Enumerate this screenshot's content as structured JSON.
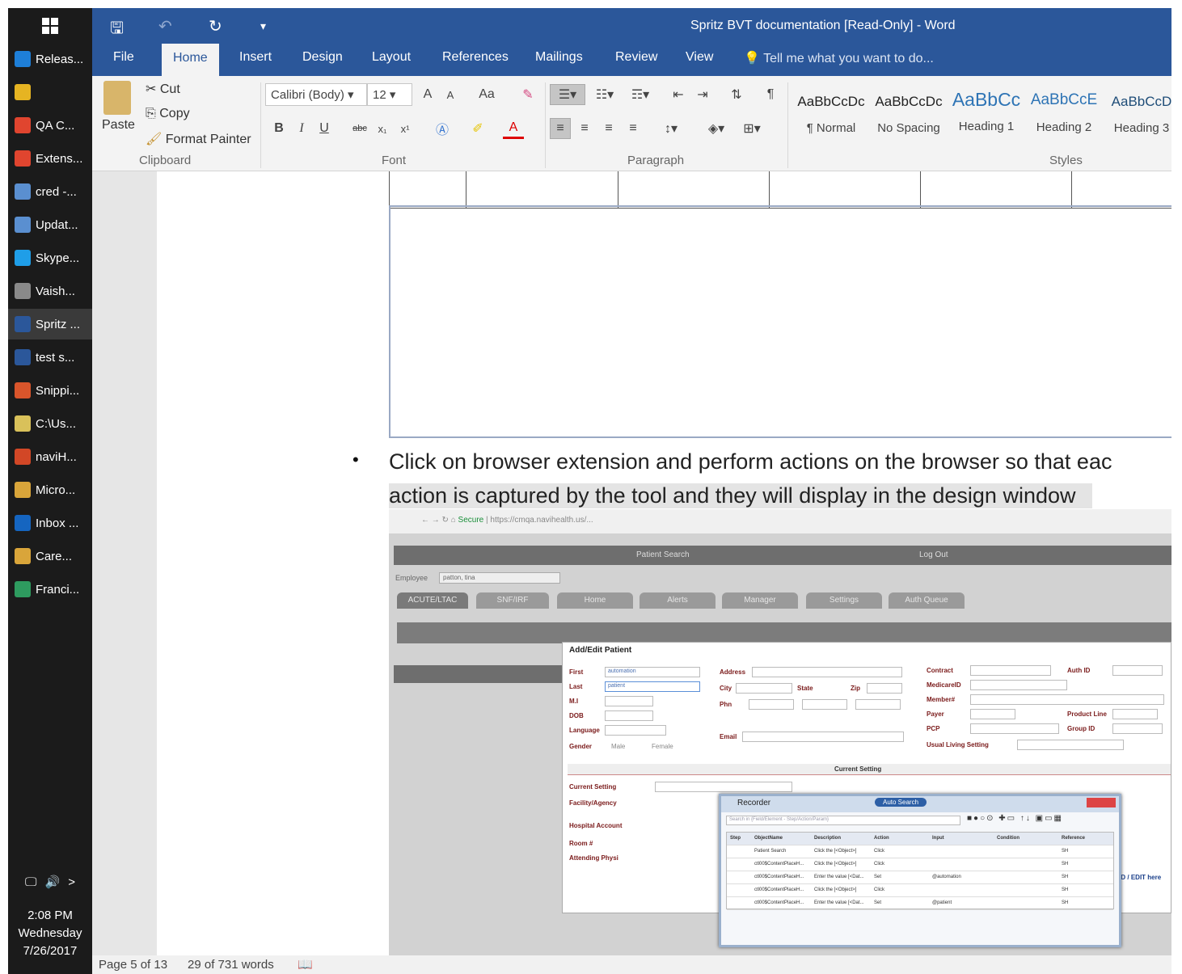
{
  "taskbar": {
    "items": [
      {
        "label": "Releas...",
        "icon": "edge-icon",
        "color": "#1e7fd8"
      },
      {
        "label": "",
        "icon": "file-explorer-icon",
        "color": "#e6b422"
      },
      {
        "label": "QA C...",
        "icon": "chrome-icon",
        "color": "#e0452f"
      },
      {
        "label": "Extens...",
        "icon": "chrome-icon",
        "color": "#e0452f"
      },
      {
        "label": "cred -...",
        "icon": "notepad-icon",
        "color": "#5a8fd0"
      },
      {
        "label": "Updat...",
        "icon": "notepad-icon",
        "color": "#5a8fd0"
      },
      {
        "label": "Skype...",
        "icon": "skype-icon",
        "color": "#1f9ee8"
      },
      {
        "label": "Vaish...",
        "icon": "app-icon",
        "color": "#8a8a8a"
      },
      {
        "label": "Spritz ...",
        "icon": "word-icon",
        "color": "#2b579a"
      },
      {
        "label": "test s...",
        "icon": "word-icon",
        "color": "#2b579a"
      },
      {
        "label": "Snippi...",
        "icon": "snipping-tool-icon",
        "color": "#d9552b"
      },
      {
        "label": "C:\\Us...",
        "icon": "folder-icon",
        "color": "#d9c15a"
      },
      {
        "label": "naviH...",
        "icon": "powerpoint-icon",
        "color": "#d24726"
      },
      {
        "label": "Micro...",
        "icon": "app-icon",
        "color": "#d9a53a"
      },
      {
        "label": "Inbox ...",
        "icon": "outlook-icon",
        "color": "#1565c0"
      },
      {
        "label": "Care...",
        "icon": "app-icon",
        "color": "#d9a53a"
      },
      {
        "label": "Franci...",
        "icon": "app-icon",
        "color": "#2e9b5f"
      }
    ],
    "time": "2:08 PM",
    "day": "Wednesday",
    "date": "7/26/2017"
  },
  "titlebar": {
    "title": "Spritz BVT documentation [Read-Only] - Word"
  },
  "tabs": [
    "File",
    "Home",
    "Insert",
    "Design",
    "Layout",
    "References",
    "Mailings",
    "Review",
    "View"
  ],
  "tell_me": "Tell me what you want to do...",
  "ribbon": {
    "clipboard": {
      "paste": "Paste",
      "cut": "Cut",
      "copy": "Copy",
      "format_painter": "Format Painter",
      "group": "Clipboard"
    },
    "font": {
      "name": "Calibri (Body)",
      "size": "12",
      "group": "Font",
      "case": "Aa",
      "bold": "B",
      "italic": "I",
      "underline": "U",
      "strike": "abc",
      "sub": "x₁",
      "sup": "x¹",
      "grow": "A",
      "shrink": "A"
    },
    "paragraph": {
      "group": "Paragraph"
    },
    "styles": {
      "group": "Styles",
      "items": [
        {
          "preview": "AaBbCcDc",
          "name": "¶ Normal"
        },
        {
          "preview": "AaBbCcDc",
          "name": "No Spacing"
        },
        {
          "preview": "AaBbCc",
          "name": "Heading 1"
        },
        {
          "preview": "AaBbCcE",
          "name": "Heading 2"
        },
        {
          "preview": "AaBbCcD",
          "name": "Heading 3"
        }
      ]
    }
  },
  "document": {
    "bullet": "•",
    "line1": "Click on browser extension and perform actions on the browser so that eac",
    "line2": "action is captured by the tool and they will display in the design window"
  },
  "screenshot": {
    "url": "https://cmqa.navihealth.us/...",
    "secure": "Secure",
    "header_center": "Patient Search",
    "header_right": "Log Out",
    "employee_label": "Employee",
    "employee_value": "patton, tina",
    "tabs": [
      "ACUTE/LTAC",
      "SNF/IRF",
      "Home",
      "Alerts",
      "Manager",
      "Settings",
      "Auth Queue"
    ],
    "dialog_title": "Add/Edit Patient",
    "labels": {
      "first": "First",
      "last": "Last",
      "mi": "M.I",
      "dob": "DOB",
      "language": "Language",
      "gender": "Gender",
      "male": "Male",
      "female": "Female",
      "address": "Address",
      "city": "City",
      "state": "State",
      "zip": "Zip",
      "phone": "Phn",
      "email": "Email",
      "contract": "Contract",
      "auth_id": "Auth ID",
      "medicare": "MedicareID",
      "member": "Member#",
      "payer": "Payer",
      "product_line": "Product Line",
      "pcp": "PCP",
      "group_id": "Group ID",
      "living": "Usual Living Setting",
      "current_setting_hdr": "Current Setting",
      "current_setting": "Current Setting",
      "facility": "Facility/Agency",
      "hospital": "Hospital Account",
      "room": "Room #",
      "attending": "Attending Physi",
      "cannot_find": "Cannot find a Physician. ADD / EDIT here"
    },
    "first_value": "automation",
    "last_value": "patient",
    "recorder": {
      "title": "Recorder",
      "search_placeholder": "Search in {Field/Element - Step/Action/Param}",
      "button": "Auto Search",
      "columns": [
        "Step",
        "ObjectName",
        "Description",
        "Action",
        "Input",
        "Condition",
        "Reference"
      ],
      "rows": [
        [
          "",
          "Patient Search",
          "Click the [<Object>]",
          "Click",
          "",
          "",
          "SH"
        ],
        [
          "",
          "ctl00$ContentPlaceH...",
          "Click the [<Object>]",
          "Click",
          "",
          "",
          "SH"
        ],
        [
          "",
          "ctl00$ContentPlaceH...",
          "Enter the value [<Dat...",
          "Set",
          "@automation",
          "",
          "SH"
        ],
        [
          "",
          "ctl00$ContentPlaceH...",
          "Click the [<Object>]",
          "Click",
          "",
          "",
          "SH"
        ],
        [
          "",
          "ctl00$ContentPlaceH...",
          "Enter the value [<Dat...",
          "Set",
          "@patient",
          "",
          "SH"
        ]
      ]
    }
  },
  "status": {
    "page": "Page 5 of 13",
    "words": "29 of 731 words"
  }
}
